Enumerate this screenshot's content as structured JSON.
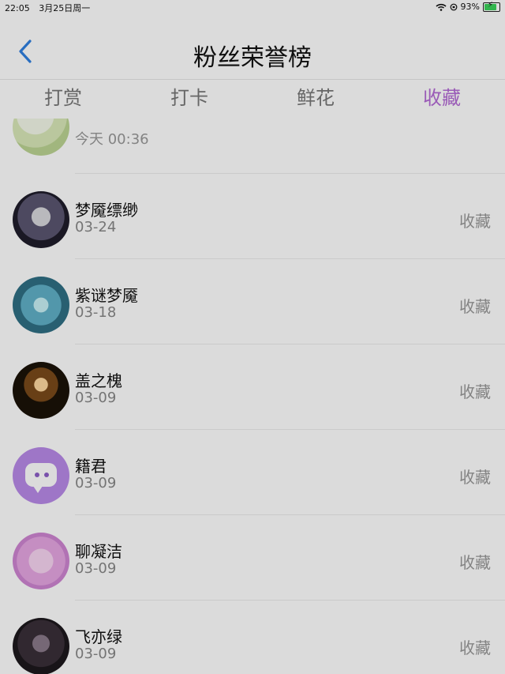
{
  "status": {
    "time": "22:05",
    "date": "3月25日周一",
    "battery_percent": "93%",
    "battery_level": 0.93
  },
  "nav": {
    "title": "粉丝荣誉榜"
  },
  "tabs": [
    {
      "label": "打赏"
    },
    {
      "label": "打卡"
    },
    {
      "label": "鲜花"
    },
    {
      "label": "收藏"
    }
  ],
  "partial_item": {
    "date": "今天 00:36"
  },
  "items": [
    {
      "name": "梦魇缥缈",
      "date": "03-24",
      "action": "收藏"
    },
    {
      "name": "紫谜梦魇",
      "date": "03-18",
      "action": "收藏"
    },
    {
      "name": "盖之槐",
      "date": "03-09",
      "action": "收藏"
    },
    {
      "name": "籍君",
      "date": "03-09",
      "action": "收藏"
    },
    {
      "name": "聊凝洁",
      "date": "03-09",
      "action": "收藏"
    },
    {
      "name": "飞亦绿",
      "date": "03-09",
      "action": "收藏"
    }
  ]
}
